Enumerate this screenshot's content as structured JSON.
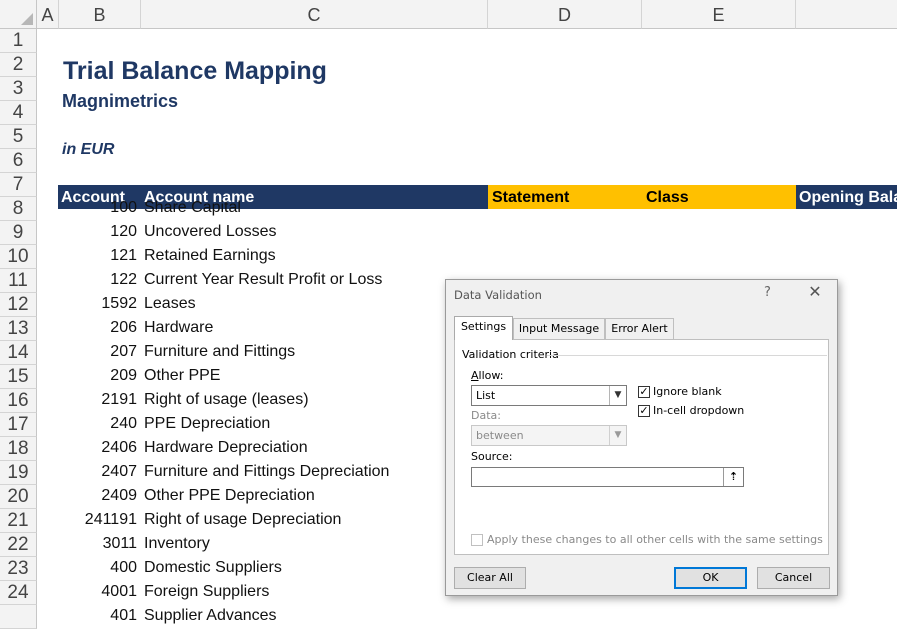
{
  "columns": [
    "A",
    "B",
    "C",
    "D",
    "E"
  ],
  "rows": [
    "1",
    "2",
    "3",
    "4",
    "5",
    "6",
    "7",
    "8",
    "9",
    "10",
    "11",
    "12",
    "13",
    "14",
    "15",
    "16",
    "17",
    "18",
    "19",
    "20",
    "21",
    "22",
    "23",
    "24",
    ""
  ],
  "title": "Trial Balance Mapping",
  "subtitle": "Magnimetrics",
  "unit_note": "in EUR",
  "table_headers": {
    "account": "Account",
    "account_name": "Account name",
    "statement": "Statement",
    "class": "Class",
    "opening_balance": "Opening Bala"
  },
  "colors": {
    "header_navy": "#1f3864",
    "header_gold": "#ffc000"
  },
  "accounts": [
    {
      "code": "100",
      "name": "Share Capital"
    },
    {
      "code": "120",
      "name": "Uncovered Losses"
    },
    {
      "code": "121",
      "name": "Retained Earnings"
    },
    {
      "code": "122",
      "name": "Current Year Result Profit or Loss"
    },
    {
      "code": "1592",
      "name": "Leases"
    },
    {
      "code": "206",
      "name": "Hardware"
    },
    {
      "code": "207",
      "name": "Furniture and Fittings"
    },
    {
      "code": "209",
      "name": "Other PPE"
    },
    {
      "code": "2191",
      "name": "Right of usage (leases)"
    },
    {
      "code": "240",
      "name": "PPE Depreciation"
    },
    {
      "code": "2406",
      "name": "Hardware Depreciation"
    },
    {
      "code": "2407",
      "name": "Furniture and Fittings Depreciation"
    },
    {
      "code": "2409",
      "name": "Other PPE Depreciation"
    },
    {
      "code": "241191",
      "name": "Right of usage Depreciation"
    },
    {
      "code": "3011",
      "name": "Inventory"
    },
    {
      "code": "400",
      "name": "Domestic Suppliers"
    },
    {
      "code": "4001",
      "name": "Foreign Suppliers"
    },
    {
      "code": "401",
      "name": "Supplier Advances"
    }
  ],
  "dialog": {
    "title": "Data Validation",
    "help": "?",
    "close_icon": "close-icon",
    "tabs": [
      "Settings",
      "Input Message",
      "Error Alert"
    ],
    "section_label": "Validation criteria",
    "allow_label": "Allow:",
    "allow_value": "List",
    "data_label": "Data:",
    "data_value": "between",
    "ignore_blank": {
      "label": "Ignore blank",
      "checked": true
    },
    "in_cell_dropdown": {
      "label": "In-cell dropdown",
      "checked": true
    },
    "source_label": "Source:",
    "source_value": "",
    "apply_all": {
      "label": "Apply these changes to all other cells with the same settings",
      "checked": false
    },
    "buttons": {
      "clear_all": "Clear All",
      "ok": "OK",
      "cancel": "Cancel"
    }
  }
}
